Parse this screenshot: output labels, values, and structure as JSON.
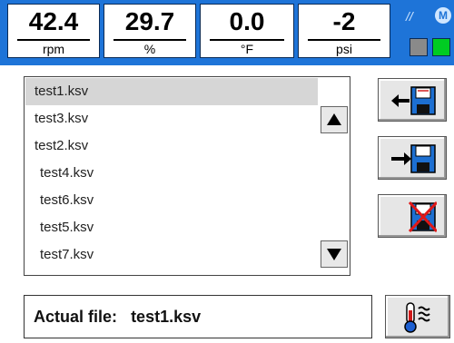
{
  "gauges": [
    {
      "value": "42.4",
      "unit": "rpm"
    },
    {
      "value": "29.7",
      "unit": "%"
    },
    {
      "value": "0.0",
      "unit": "°F"
    },
    {
      "value": "-2",
      "unit": "psi"
    }
  ],
  "status": {
    "link_symbol": "//",
    "mode_letter": "M",
    "leds": [
      "#8a8a8a",
      "#00cc22"
    ]
  },
  "file_list": {
    "items": [
      "test1.ksv",
      "test3.ksv",
      "test2.ksv",
      "test4.ksv",
      "test6.ksv",
      "test5.ksv",
      "test7.ksv"
    ],
    "selected_index": 0
  },
  "buttons": {
    "load_icon": "load-from-disk-icon",
    "save_icon": "save-to-disk-icon",
    "delete_icon": "delete-file-icon",
    "temperature_icon": "thermometer-icon"
  },
  "actual_file": {
    "label": "Actual file:",
    "name": "test1.ksv"
  }
}
